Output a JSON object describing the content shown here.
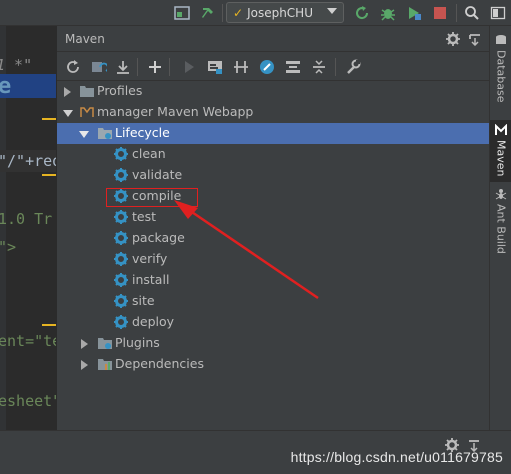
{
  "toolbar": {
    "user": "JosephCHU",
    "icons": [
      "run-config-icon",
      "build-hammer-icon",
      "update-icon",
      "debug-bug-icon",
      "coverage-icon",
      "stop-icon",
      "search-icon",
      "layout-icon"
    ],
    "colors": {
      "green": "#59a869",
      "red": "#c75450",
      "accent": "#e6b422"
    }
  },
  "editor": {
    "snippets": [
      "1 *\"",
      "e",
      "\"/\"+req",
      "1.0 Tr",
      "\">",
      "ent=\"te",
      "esheet\""
    ]
  },
  "maven": {
    "title": "Maven",
    "tree": {
      "profiles": "Profiles",
      "project": "manager Maven Webapp",
      "lifecycle": "Lifecycle",
      "phases": [
        "clean",
        "validate",
        "compile",
        "test",
        "package",
        "verify",
        "install",
        "site",
        "deploy"
      ],
      "plugins": "Plugins",
      "dependencies": "Dependencies"
    },
    "selection_color": "#4b6eaf",
    "gear_color": "#3592c4"
  },
  "side_tabs": [
    "Database",
    "Maven",
    "Ant Build"
  ],
  "watermark": "https://blog.csdn.net/u011679785",
  "annotation": {
    "color": "#e02020",
    "target": "compile"
  }
}
